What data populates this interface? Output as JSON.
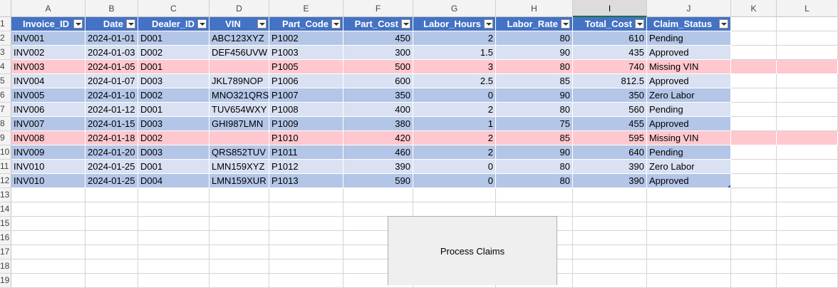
{
  "columns": [
    "A",
    "B",
    "C",
    "D",
    "E",
    "F",
    "G",
    "H",
    "I",
    "J",
    "K",
    "L"
  ],
  "selected_column": "I",
  "row_numbers": [
    "1",
    "2",
    "3",
    "4",
    "5",
    "6",
    "7",
    "8",
    "9",
    "10",
    "11",
    "12",
    "13",
    "14",
    "15",
    "16",
    "17",
    "18",
    "19"
  ],
  "table": {
    "headers": [
      "Invoice_ID",
      "Date",
      "Dealer_ID",
      "VIN",
      "Part_Code",
      "Part_Cost",
      "Labor_Hours",
      "Labor_Rate",
      "Total_Cost",
      "Claim_Status"
    ],
    "rows": [
      {
        "cells": [
          "INV001",
          "2024-01-01",
          "D001",
          "ABC123XYZ",
          "P1002",
          "450",
          "2",
          "80",
          "610",
          "Pending"
        ],
        "highlight": false
      },
      {
        "cells": [
          "INV002",
          "2024-01-03",
          "D002",
          "DEF456UVW",
          "P1003",
          "300",
          "1.5",
          "90",
          "435",
          "Approved"
        ],
        "highlight": false
      },
      {
        "cells": [
          "INV003",
          "2024-01-05",
          "D001",
          "",
          "P1005",
          "500",
          "3",
          "80",
          "740",
          "Missing VIN"
        ],
        "highlight": true
      },
      {
        "cells": [
          "INV004",
          "2024-01-07",
          "D003",
          "JKL789NOP",
          "P1006",
          "600",
          "2.5",
          "85",
          "812.5",
          "Approved"
        ],
        "highlight": false
      },
      {
        "cells": [
          "INV005",
          "2024-01-10",
          "D002",
          "MNO321QRS",
          "P1007",
          "350",
          "0",
          "90",
          "350",
          "Zero Labor"
        ],
        "highlight": false
      },
      {
        "cells": [
          "INV006",
          "2024-01-12",
          "D001",
          "TUV654WXY",
          "P1008",
          "400",
          "2",
          "80",
          "560",
          "Pending"
        ],
        "highlight": false
      },
      {
        "cells": [
          "INV007",
          "2024-01-15",
          "D003",
          "GHI987LMN",
          "P1009",
          "380",
          "1",
          "75",
          "455",
          "Approved"
        ],
        "highlight": false
      },
      {
        "cells": [
          "INV008",
          "2024-01-18",
          "D002",
          "",
          "P1010",
          "420",
          "2",
          "85",
          "595",
          "Missing VIN"
        ],
        "highlight": true
      },
      {
        "cells": [
          "INV009",
          "2024-01-20",
          "D003",
          "QRS852TUV",
          "P1011",
          "460",
          "2",
          "90",
          "640",
          "Pending"
        ],
        "highlight": false
      },
      {
        "cells": [
          "INV010",
          "2024-01-25",
          "D001",
          "LMN159XYZ",
          "P1012",
          "390",
          "0",
          "80",
          "390",
          "Zero Labor"
        ],
        "highlight": false
      },
      {
        "cells": [
          "INV010",
          "2024-01-25",
          "D004",
          "LMN159XUR",
          "P1013",
          "590",
          "0",
          "80",
          "390",
          "Approved"
        ],
        "highlight": false
      }
    ]
  },
  "process_button": {
    "label": "Process Claims"
  },
  "colors": {
    "header_fill": "#4472c4",
    "band_dark": "#b4c6e7",
    "band_light": "#d9e1f2",
    "missing_vin_fill": "#ffc7ce"
  }
}
